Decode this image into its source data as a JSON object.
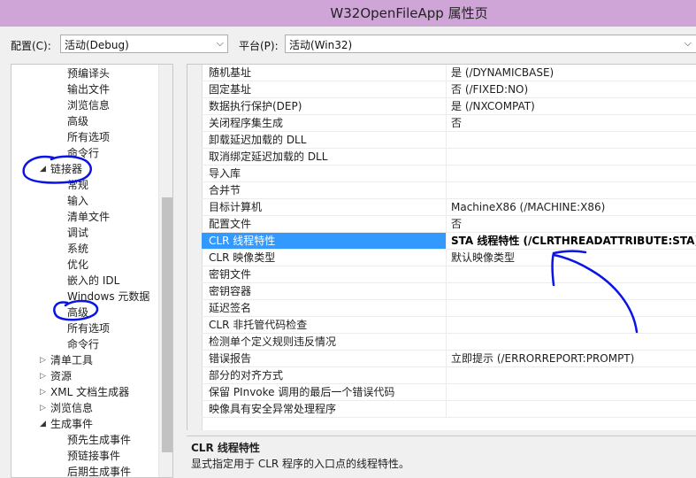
{
  "window": {
    "title": "W32OpenFileApp 属性页"
  },
  "config_bar": {
    "config_label": "配置(C):",
    "config_value": "活动(Debug)",
    "platform_label": "平台(P):",
    "platform_value": "活动(Win32)"
  },
  "tree": {
    "items": [
      {
        "label": "预编译头"
      },
      {
        "label": "输出文件"
      },
      {
        "label": "浏览信息"
      },
      {
        "label": "高级"
      },
      {
        "label": "所有选项"
      },
      {
        "label": "命令行"
      },
      {
        "label": "链接器"
      },
      {
        "label": "常规"
      },
      {
        "label": "输入"
      },
      {
        "label": "清单文件"
      },
      {
        "label": "调试"
      },
      {
        "label": "系统"
      },
      {
        "label": "优化"
      },
      {
        "label": "嵌入的 IDL"
      },
      {
        "label": "Windows 元数据"
      },
      {
        "label": "高级"
      },
      {
        "label": "所有选项"
      },
      {
        "label": "命令行"
      },
      {
        "label": "清单工具"
      },
      {
        "label": "资源"
      },
      {
        "label": "XML 文档生成器"
      },
      {
        "label": "浏览信息"
      },
      {
        "label": "生成事件"
      },
      {
        "label": "预先生成事件"
      },
      {
        "label": "预链接事件"
      },
      {
        "label": "后期生成事件"
      }
    ]
  },
  "properties": [
    {
      "name": "随机基址",
      "value": "是 (/DYNAMICBASE)"
    },
    {
      "name": "固定基址",
      "value": "否 (/FIXED:NO)"
    },
    {
      "name": "数据执行保护(DEP)",
      "value": "是 (/NXCOMPAT)"
    },
    {
      "name": "关闭程序集生成",
      "value": "否"
    },
    {
      "name": "卸载延迟加载的 DLL",
      "value": ""
    },
    {
      "name": "取消绑定延迟加载的 DLL",
      "value": ""
    },
    {
      "name": "导入库",
      "value": ""
    },
    {
      "name": "合并节",
      "value": ""
    },
    {
      "name": "目标计算机",
      "value": "MachineX86 (/MACHINE:X86)"
    },
    {
      "name": "配置文件",
      "value": "否"
    },
    {
      "name": "CLR 线程特性",
      "value": "STA 线程特性 (/CLRTHREADATTRIBUTE:STA)"
    },
    {
      "name": "CLR 映像类型",
      "value": "默认映像类型"
    },
    {
      "name": "密钥文件",
      "value": ""
    },
    {
      "name": "密钥容器",
      "value": ""
    },
    {
      "name": "延迟签名",
      "value": ""
    },
    {
      "name": "CLR 非托管代码检查",
      "value": ""
    },
    {
      "name": "检测单个定义规则违反情况",
      "value": ""
    },
    {
      "name": "错误报告",
      "value": "立即提示 (/ERRORREPORT:PROMPT)"
    },
    {
      "name": "部分的对齐方式",
      "value": ""
    },
    {
      "name": "保留 PInvoke 调用的最后一个错误代码",
      "value": ""
    },
    {
      "name": "映像具有安全异常处理程序",
      "value": ""
    }
  ],
  "description": {
    "title": "CLR 线程特性",
    "text": "显式指定用于 CLR 程序的入口点的线程特性。"
  },
  "colors": {
    "selection": "#3399ff",
    "titlebar": "#cfa5d8",
    "annotation_ink": "#0a14e6"
  }
}
